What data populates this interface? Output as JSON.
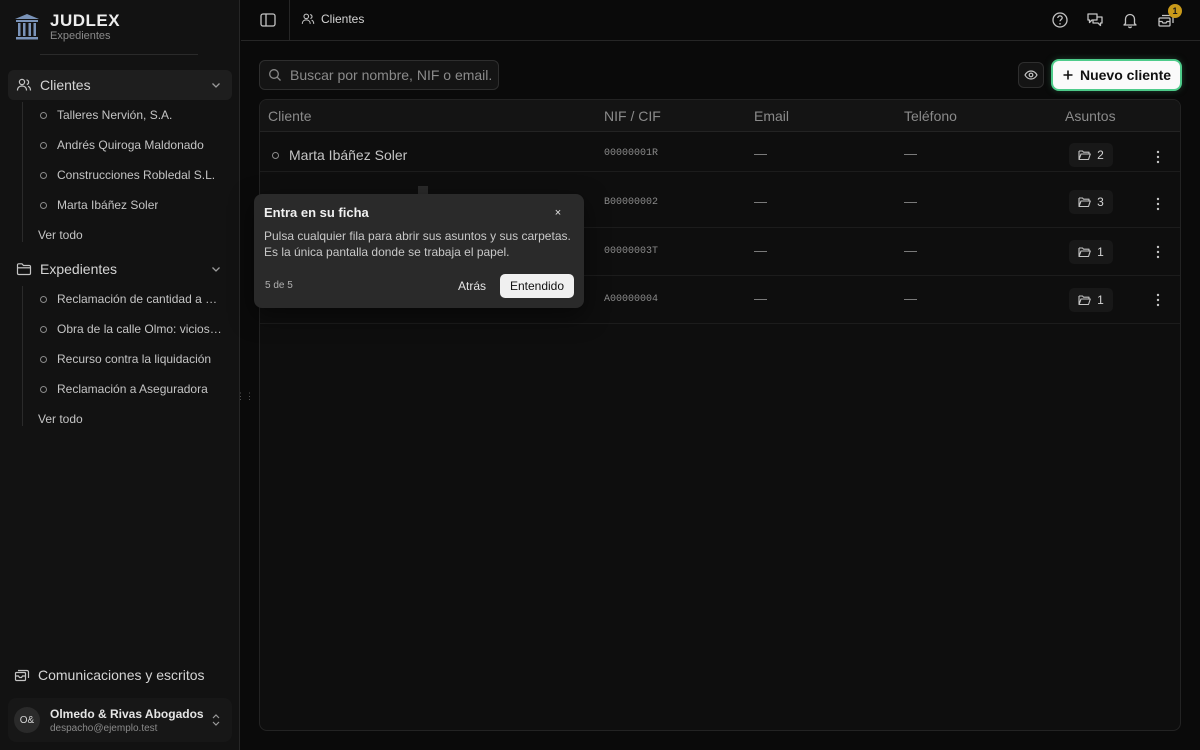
{
  "brand": {
    "name": "JUDLEX",
    "subtitle": "Expedientes"
  },
  "sidebar": {
    "groups": [
      {
        "label": "Clientes",
        "items": [
          "Talleres Nervión, S.A.",
          "Andrés Quiroga Maldonado",
          "Construcciones Robledal S.L.",
          "Marta Ibáñez Soler"
        ],
        "view_all": "Ver todo"
      },
      {
        "label": "Expedientes",
        "items": [
          "Reclamación de cantidad a cliente",
          "Obra de la calle Olmo: vicios ocultos",
          "Recurso contra la liquidación",
          "Reclamación a Aseguradora"
        ],
        "view_all": "Ver todo"
      }
    ],
    "comms_label": "Comunicaciones y escritos",
    "account": {
      "initials": "O&",
      "name": "Olmedo & Rivas Abogados",
      "email": "despacho@ejemplo.test"
    }
  },
  "topbar": {
    "breadcrumb": "Clientes",
    "notification_count": "1"
  },
  "toolbar": {
    "search_placeholder": "Buscar por nombre, NIF o email.",
    "new_button_label": "Nuevo cliente"
  },
  "table": {
    "headers": {
      "cliente": "Cliente",
      "nif": "NIF / CIF",
      "email": "Email",
      "telefono": "Teléfono",
      "asuntos": "Asuntos"
    },
    "rows": [
      {
        "name": "Marta Ibáñez Soler",
        "nif": "00000001R",
        "email": "—",
        "phone": "—",
        "asuntos": "2"
      },
      {
        "name": "",
        "nif": "B00000002",
        "email": "—",
        "phone": "—",
        "asuntos": "3"
      },
      {
        "name": "",
        "nif": "00000003T",
        "email": "—",
        "phone": "—",
        "asuntos": "1"
      },
      {
        "name": "",
        "nif": "A00000004",
        "email": "—",
        "phone": "—",
        "asuntos": "1"
      }
    ]
  },
  "tour": {
    "title": "Entra en su ficha",
    "body": "Pulsa cualquier fila para abrir sus asuntos y sus carpetas. Es la única pantalla donde se trabaja el papel.",
    "step": "5 de 5",
    "back_label": "Atrás",
    "ok_label": "Entendido",
    "close_glyph": "×"
  }
}
